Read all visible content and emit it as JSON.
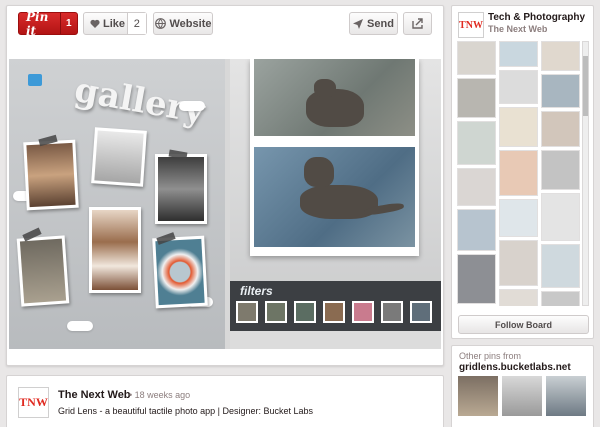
{
  "action_bar": {
    "pin_label": "Pin it",
    "pin_count": "1",
    "like_label": "Like",
    "like_count": "2",
    "website_label": "Website",
    "send_label": "Send"
  },
  "pin_image": {
    "gallery_word": "gallery",
    "filters_label": "filters"
  },
  "attribution": {
    "logo_text": "TNW",
    "name": "The Next Web",
    "time": "• 18 weeks ago",
    "description": "Grid Lens - a beautiful tactile photo app | Designer: Bucket Labs"
  },
  "board": {
    "logo_text": "TNW",
    "title": "Tech & Photography",
    "owner": "The Next Web",
    "follow_label": "Follow Board"
  },
  "other_pins": {
    "label": "Other pins from",
    "source": "gridlens.bucketlabs.net"
  },
  "colors": {
    "pin_red": "#cb2027",
    "accent_blue": "#3d9ad8",
    "background": "#e9e7e7"
  }
}
